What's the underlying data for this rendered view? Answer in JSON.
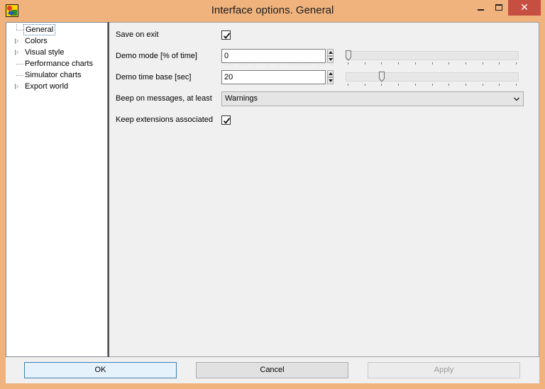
{
  "window": {
    "title": "Interface options. General",
    "minimize_glyph": "",
    "maximize_glyph": "",
    "close_glyph": "✕",
    "frame_color": "#f0b37e",
    "close_color": "#c74f42"
  },
  "tree": {
    "items": [
      {
        "label": "General",
        "selected": true,
        "expandable": false
      },
      {
        "label": "Colors",
        "selected": false,
        "expandable": true
      },
      {
        "label": "Visual style",
        "selected": false,
        "expandable": true
      },
      {
        "label": "Performance charts",
        "selected": false,
        "expandable": false
      },
      {
        "label": "Simulator charts",
        "selected": false,
        "expandable": false
      },
      {
        "label": "Export world",
        "selected": false,
        "expandable": true
      }
    ]
  },
  "general": {
    "save_on_exit": {
      "label": "Save on exit",
      "checked": true
    },
    "demo_mode": {
      "label": "Demo mode [% of time]",
      "value": "0",
      "slider_fraction": 0.0
    },
    "demo_time_base": {
      "label": "Demo time base [sec]",
      "value": "20",
      "slider_fraction": 0.2
    },
    "beep": {
      "label": "Beep on messages, at least",
      "selected": "Warnings"
    },
    "keep_ext": {
      "label": "Keep extensions associated",
      "checked": true
    }
  },
  "buttons": {
    "ok": "OK",
    "cancel": "Cancel",
    "apply": "Apply"
  },
  "watermark": "SOFTPEDIA"
}
